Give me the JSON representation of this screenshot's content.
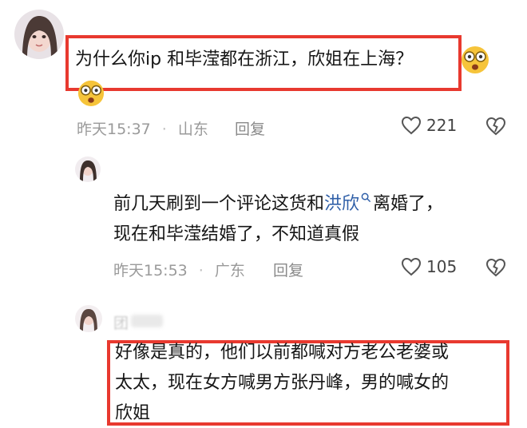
{
  "comments": [
    {
      "text": "为什么你ip 和毕滢都在浙江，欣姐在上海？",
      "time": "昨天15:37",
      "location": "山东",
      "reply_label": "回复",
      "likes": "221"
    },
    {
      "text_line1_a": "前几天刷到一个评论这货和",
      "text_line1_link": "洪欣",
      "text_line1_b": "离婚了，",
      "text_line2": "现在和毕滢结婚了，不知道真假",
      "time": "昨天15:53",
      "location": "广东",
      "reply_label": "回复",
      "likes": "105"
    },
    {
      "nick_partial": "团",
      "text_line1": "好像是真的，他们以前都喊对方老公老婆或",
      "text_line2": "太太，现在女方喊男方张丹峰，男的喊女的",
      "text_line3": "欣姐"
    }
  ],
  "colors": {
    "highlight_box": "#e8392f",
    "link": "#2f5fa8",
    "meta": "#9a9a9a"
  }
}
